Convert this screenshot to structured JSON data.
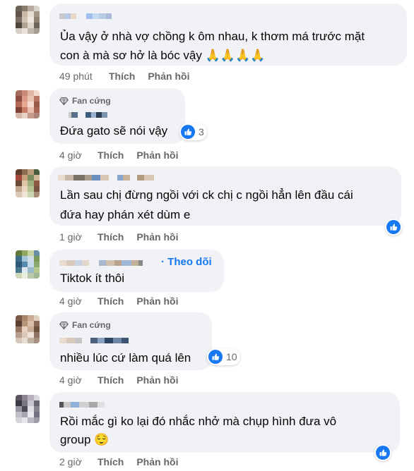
{
  "labels": {
    "like": "Thích",
    "reply": "Phản hồi",
    "fan_badge": "Fan cứng",
    "follow": "Theo dõi"
  },
  "colors": {
    "bubble": "#f0f2f5",
    "link": "#1877f2",
    "meta": "#65676b"
  },
  "comments": [
    {
      "line1": "Ủa vậy ở nhà vợ chồng k ôm nhau, k thơm má trước mặt",
      "line2": "con à mà sơ hở là bóc vậy 🙏🙏🙏🙏",
      "time": "49 phút"
    },
    {
      "line1": "Đứa gato sẽ nói vậy",
      "time": "4 giờ",
      "reactions": "3",
      "reaction_icon": "like-icon"
    },
    {
      "line1": "Lần sau chị đừng ngồi với ck chị c ngồi hẳn lên đầu cái",
      "line2": "đứa hay phán xét dùm e",
      "time": "1 giờ",
      "reaction_icon": "like-icon"
    },
    {
      "line1": "Tiktok ít thôi",
      "time": "4 giờ"
    },
    {
      "line1": "nhiều lúc cứ làm quá lên",
      "time": "4 giờ",
      "reactions": "10",
      "reaction_icon": "like-icon"
    },
    {
      "line1": "Rồi mắc gì ko lại đó nhắc nhở mà chụp hình đưa vô",
      "line2": "group 😌",
      "time": "2 giờ",
      "reaction_icon": "like-icon"
    }
  ]
}
